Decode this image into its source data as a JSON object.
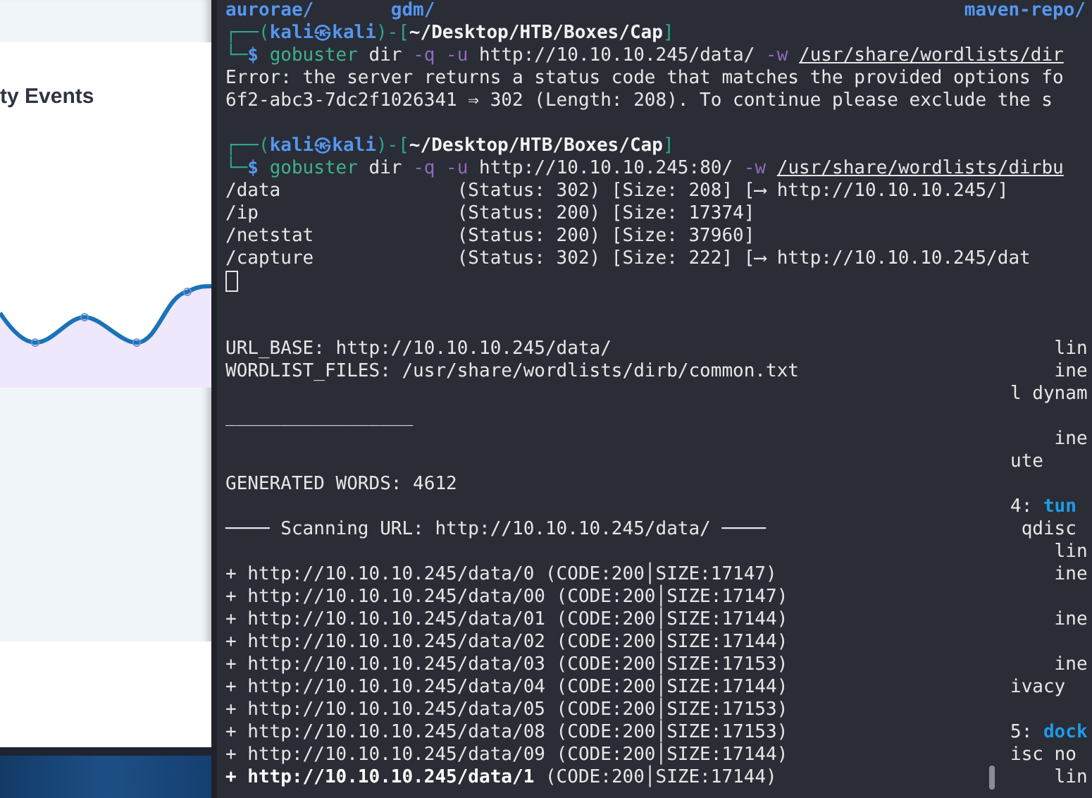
{
  "browser": {
    "card_title": "ty Events"
  },
  "terminal": {
    "lines": [
      {
        "kind": "text",
        "segments": [
          {
            "kind": "listing",
            "text": "aurorae/       gdm/                                                maven-repo/"
          }
        ]
      },
      {
        "kind": "text",
        "segments": [
          {
            "kind": "frame",
            "text": "┌──("
          },
          {
            "kind": "user",
            "text": "kali㉿kali"
          },
          {
            "kind": "frame",
            "text": ")-["
          },
          {
            "kind": "path",
            "text": "~/Desktop/HTB/Boxes/Cap"
          },
          {
            "kind": "frame",
            "text": "]"
          }
        ]
      },
      {
        "kind": "text",
        "segments": [
          {
            "kind": "frame",
            "text": "└─"
          },
          {
            "kind": "dollar",
            "text": "$ "
          },
          {
            "kind": "cmd",
            "text": "gobuster"
          },
          {
            "kind": "plain",
            "text": " dir "
          },
          {
            "kind": "flag",
            "text": "-q -u"
          },
          {
            "kind": "plain",
            "text": " http://10.10.10.245/data/ "
          },
          {
            "kind": "flag",
            "text": "-w "
          },
          {
            "kind": "link",
            "text": "/usr/share/wordlists/dir"
          }
        ]
      },
      {
        "kind": "text",
        "segments": [
          {
            "kind": "plain",
            "text": "Error: the server returns a status code that matches the provided options fo"
          }
        ]
      },
      {
        "kind": "text",
        "segments": [
          {
            "kind": "plain",
            "text": "6f2-abc3-7dc2f1026341 ⇒ 302 (Length: 208). To continue please exclude the s"
          }
        ]
      },
      {
        "kind": "blank"
      },
      {
        "kind": "text",
        "segments": [
          {
            "kind": "frame",
            "text": "┌──("
          },
          {
            "kind": "user",
            "text": "kali㉿kali"
          },
          {
            "kind": "frame",
            "text": ")-["
          },
          {
            "kind": "path",
            "text": "~/Desktop/HTB/Boxes/Cap"
          },
          {
            "kind": "frame",
            "text": "]"
          }
        ]
      },
      {
        "kind": "text",
        "segments": [
          {
            "kind": "frame",
            "text": "└─"
          },
          {
            "kind": "dollar",
            "text": "$ "
          },
          {
            "kind": "cmd",
            "text": "gobuster"
          },
          {
            "kind": "plain",
            "text": " dir "
          },
          {
            "kind": "flag",
            "text": "-q -u"
          },
          {
            "kind": "plain",
            "text": " http://10.10.10.245:80/ "
          },
          {
            "kind": "flag",
            "text": "-w "
          },
          {
            "kind": "link",
            "text": "/usr/share/wordlists/dirbu"
          }
        ]
      },
      {
        "kind": "text",
        "segments": [
          {
            "kind": "plain",
            "text": "/data                (Status: 302) [Size: 208] [⟶ http://10.10.10.245/]"
          }
        ]
      },
      {
        "kind": "text",
        "segments": [
          {
            "kind": "plain",
            "text": "/ip                  (Status: 200) [Size: 17374]"
          }
        ]
      },
      {
        "kind": "text",
        "segments": [
          {
            "kind": "plain",
            "text": "/netstat             (Status: 200) [Size: 37960]"
          }
        ]
      },
      {
        "kind": "text",
        "segments": [
          {
            "kind": "plain",
            "text": "/capture             (Status: 302) [Size: 222] [⟶ http://10.10.10.245/dat"
          }
        ]
      },
      {
        "kind": "cursor"
      },
      {
        "kind": "blank"
      },
      {
        "kind": "blank"
      }
    ]
  },
  "output": {
    "lines": [
      {
        "kind": "text",
        "segments": [
          {
            "kind": "plain",
            "text": "URL_BASE: http://10.10.10.245/data/"
          }
        ]
      },
      {
        "kind": "text",
        "segments": [
          {
            "kind": "plain",
            "text": "WORDLIST_FILES: /usr/share/wordlists/dirb/common.txt"
          }
        ]
      },
      {
        "kind": "blank"
      },
      {
        "kind": "text",
        "segments": [
          {
            "kind": "plain",
            "text": "_________________"
          }
        ]
      },
      {
        "kind": "blank"
      },
      {
        "kind": "blank"
      },
      {
        "kind": "text",
        "segments": [
          {
            "kind": "plain",
            "text": "GENERATED WORDS: 4612"
          }
        ]
      },
      {
        "kind": "blank"
      },
      {
        "kind": "text",
        "segments": [
          {
            "kind": "plain",
            "text": "──── Scanning URL: http://10.10.10.245/data/ ────"
          }
        ]
      },
      {
        "kind": "blank"
      },
      {
        "kind": "text",
        "segments": [
          {
            "kind": "plain",
            "text": "+ http://10.10.10.245/data/0 (CODE:200│SIZE:17147)"
          }
        ]
      },
      {
        "kind": "text",
        "segments": [
          {
            "kind": "plain",
            "text": "+ http://10.10.10.245/data/00 (CODE:200│SIZE:17147)"
          }
        ]
      },
      {
        "kind": "text",
        "segments": [
          {
            "kind": "plain",
            "text": "+ http://10.10.10.245/data/01 (CODE:200│SIZE:17144)"
          }
        ]
      },
      {
        "kind": "text",
        "segments": [
          {
            "kind": "plain",
            "text": "+ http://10.10.10.245/data/02 (CODE:200│SIZE:17144)"
          }
        ]
      },
      {
        "kind": "text",
        "segments": [
          {
            "kind": "plain",
            "text": "+ http://10.10.10.245/data/03 (CODE:200│SIZE:17153)"
          }
        ]
      },
      {
        "kind": "text",
        "segments": [
          {
            "kind": "plain",
            "text": "+ http://10.10.10.245/data/04 (CODE:200│SIZE:17144)"
          }
        ]
      },
      {
        "kind": "text",
        "segments": [
          {
            "kind": "plain",
            "text": "+ http://10.10.10.245/data/05 (CODE:200│SIZE:17153)"
          }
        ]
      },
      {
        "kind": "text",
        "segments": [
          {
            "kind": "plain",
            "text": "+ http://10.10.10.245/data/08 (CODE:200│SIZE:17153)"
          }
        ]
      },
      {
        "kind": "text",
        "segments": [
          {
            "kind": "plain",
            "text": "+ http://10.10.10.245/data/09 (CODE:200│SIZE:17144)"
          }
        ]
      },
      {
        "kind": "text",
        "segments": [
          {
            "kind": "bold",
            "text": "+ http://10.10.10.245/data/1"
          },
          {
            "kind": "plain",
            "text": " (CODE:200│SIZE:17144)"
          }
        ]
      }
    ]
  },
  "side_terminal": {
    "lines": [
      {
        "kind": "text",
        "segments": [
          {
            "kind": "plain",
            "text": "    lin"
          }
        ]
      },
      {
        "kind": "text",
        "segments": [
          {
            "kind": "plain",
            "text": "    ine"
          }
        ]
      },
      {
        "kind": "text",
        "segments": [
          {
            "kind": "plain",
            "text": "l dynam"
          }
        ]
      },
      {
        "kind": "blank"
      },
      {
        "kind": "text",
        "segments": [
          {
            "kind": "plain",
            "text": "    ine"
          }
        ]
      },
      {
        "kind": "text",
        "segments": [
          {
            "kind": "plain",
            "text": "ute"
          }
        ]
      },
      {
        "kind": "blank"
      },
      {
        "kind": "text",
        "segments": [
          {
            "kind": "plain",
            "text": "4: "
          },
          {
            "kind": "iface",
            "text": "tun"
          }
        ]
      },
      {
        "kind": "text",
        "segments": [
          {
            "kind": "plain",
            "text": " qdisc"
          }
        ]
      },
      {
        "kind": "text",
        "segments": [
          {
            "kind": "plain",
            "text": "    lin"
          }
        ]
      },
      {
        "kind": "text",
        "segments": [
          {
            "kind": "plain",
            "text": "    ine"
          }
        ]
      },
      {
        "kind": "blank"
      },
      {
        "kind": "text",
        "segments": [
          {
            "kind": "plain",
            "text": "    ine"
          }
        ]
      },
      {
        "kind": "blank"
      },
      {
        "kind": "text",
        "segments": [
          {
            "kind": "plain",
            "text": "    ine"
          }
        ]
      },
      {
        "kind": "text",
        "segments": [
          {
            "kind": "plain",
            "text": "ivacy"
          }
        ]
      },
      {
        "kind": "blank"
      },
      {
        "kind": "text",
        "segments": [
          {
            "kind": "plain",
            "text": "5: "
          },
          {
            "kind": "iface",
            "text": "dock"
          }
        ]
      },
      {
        "kind": "text",
        "segments": [
          {
            "kind": "plain",
            "text": "isc no"
          }
        ]
      },
      {
        "kind": "text",
        "segments": [
          {
            "kind": "plain",
            "text": "    lin"
          }
        ]
      }
    ]
  }
}
